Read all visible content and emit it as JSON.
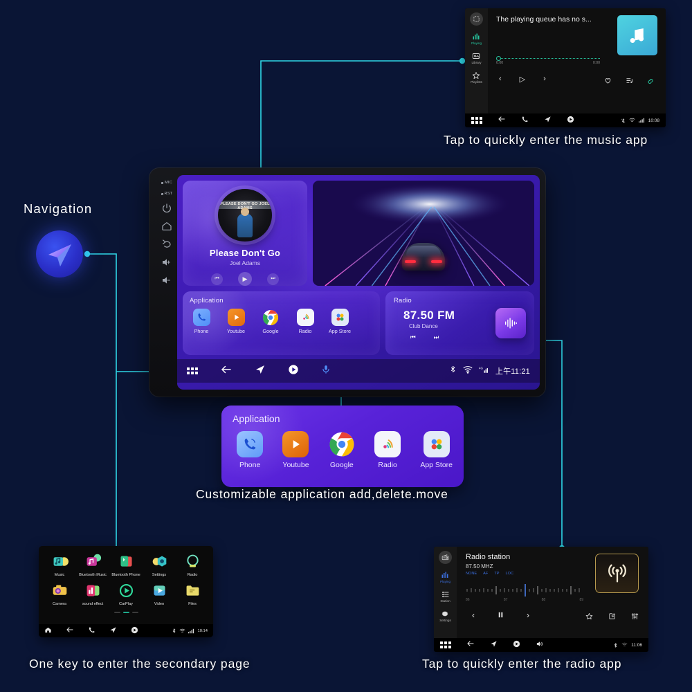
{
  "theme": {
    "bg": "#0a1535",
    "connector": "#2fd8e8",
    "accent_purple": "#6b34e8"
  },
  "navigation_callout": {
    "title": "Navigation",
    "icon": "navigation-arrow-icon"
  },
  "captions": {
    "music": "Tap to quickly enter the music app",
    "customizable": "Customizable application add,delete.move",
    "secondary": "One key to enter the secondary page",
    "radio": "Tap to quickly enter the radio app"
  },
  "head_unit": {
    "side_buttons": [
      {
        "label": "MIC",
        "icon": "mic-pinhole-icon"
      },
      {
        "label": "RST",
        "icon": "reset-pinhole-icon"
      },
      {
        "label": "",
        "icon": "power-icon"
      },
      {
        "label": "",
        "icon": "home-icon"
      },
      {
        "label": "",
        "icon": "back-icon"
      },
      {
        "label": "",
        "icon": "volume-up-icon"
      },
      {
        "label": "",
        "icon": "volume-down-icon"
      }
    ],
    "music_card": {
      "title": "Please Don't Go",
      "artist": "Joel Adams",
      "album_art_text": "PLEASE DON'T GO JOEL ADAMS",
      "controls": [
        {
          "name": "previous-button",
          "glyph": "⏮"
        },
        {
          "name": "play-button",
          "glyph": "▶"
        },
        {
          "name": "next-button",
          "glyph": "⏭"
        }
      ]
    },
    "application_card": {
      "label": "Application",
      "apps": [
        {
          "name": "Phone",
          "icon": "phone-icon",
          "color": "#4f8ef7"
        },
        {
          "name": "Youtube",
          "icon": "youtube-icon",
          "color": "#e8740c"
        },
        {
          "name": "Google",
          "icon": "google-chrome-icon",
          "color": "#ffffff"
        },
        {
          "name": "Radio",
          "icon": "radio-waves-icon",
          "color": "#f2f4f8"
        },
        {
          "name": "App Store",
          "icon": "app-store-icon",
          "color": "#dfe6f5"
        }
      ]
    },
    "radio_card": {
      "label": "Radio",
      "frequency": "87.50 FM",
      "station": "Club Dance",
      "controls": [
        {
          "name": "prev-station-button",
          "glyph": "⏮"
        },
        {
          "name": "next-station-button",
          "glyph": "⏭"
        }
      ],
      "tile_icon": "audio-wave-icon"
    },
    "navbar": {
      "items": [
        {
          "name": "apps-grid-button",
          "icon": "grid-icon"
        },
        {
          "name": "back-button",
          "icon": "arrow-left-icon"
        },
        {
          "name": "navigation-button",
          "icon": "navigation-arrow-icon"
        },
        {
          "name": "media-button",
          "icon": "play-circle-icon"
        },
        {
          "name": "voice-button",
          "icon": "microphone-icon"
        }
      ],
      "status": {
        "bluetooth": "bluetooth-icon",
        "wifi": "wifi-icon",
        "signal": "signal-4g-icon",
        "time": "上午11:21"
      }
    }
  },
  "music_app": {
    "sidebar": [
      {
        "label": "",
        "icon": "album-round-icon",
        "active": false
      },
      {
        "label": "Playing",
        "icon": "equalizer-icon",
        "active": true
      },
      {
        "label": "Library",
        "icon": "library-icon",
        "active": false
      },
      {
        "label": "Playlists",
        "icon": "star-icon",
        "active": false
      }
    ],
    "queue_message": "The playing queue has no s...",
    "progress": {
      "elapsed": "0:00",
      "total": "0:00",
      "percent": 0
    },
    "controls": [
      {
        "name": "previous-button",
        "glyph": "‹"
      },
      {
        "name": "play-button",
        "glyph": "▷"
      },
      {
        "name": "next-button",
        "glyph": "›"
      }
    ],
    "controls_right": [
      {
        "name": "favorite-icon",
        "glyph": "♡"
      },
      {
        "name": "queue-list-icon",
        "glyph": "≡"
      },
      {
        "name": "repeat-icon",
        "glyph": "∞"
      }
    ],
    "album_icon": "music-note-icon",
    "sysbar": {
      "items": [
        {
          "name": "apps-grid-button",
          "icon": "grid-icon"
        },
        {
          "name": "back-button",
          "icon": "arrow-left-icon"
        },
        {
          "name": "phone-button",
          "icon": "phone-handset-icon"
        },
        {
          "name": "navigation-button",
          "icon": "navigation-arrow-icon"
        },
        {
          "name": "media-button",
          "icon": "play-circle-icon"
        }
      ],
      "time": "10:08"
    }
  },
  "radio_app": {
    "sidebar": [
      {
        "label": "",
        "icon": "radio-device-icon",
        "active": false
      },
      {
        "label": "Playing",
        "icon": "equalizer-icon",
        "active": true
      },
      {
        "label": "Station",
        "icon": "list-icon",
        "active": false
      },
      {
        "label": "Settings",
        "icon": "gear-icon",
        "active": false
      }
    ],
    "title": "Radio station",
    "frequency": "87.50 MHZ",
    "tags": [
      "NONE",
      "AF",
      "TP",
      "LOC"
    ],
    "scale_labels": [
      "86",
      "87",
      "88",
      "89"
    ],
    "current_mark": 87.5,
    "controls": [
      {
        "name": "tune-down-button",
        "glyph": "‹"
      },
      {
        "name": "pause-button",
        "glyph": "⏸"
      },
      {
        "name": "tune-up-button",
        "glyph": "›"
      }
    ],
    "controls_right": [
      {
        "name": "favorite-icon",
        "glyph": "☆"
      },
      {
        "name": "edit-icon",
        "glyph": "✎"
      },
      {
        "name": "equalizer-icon",
        "glyph": "≡"
      }
    ],
    "tile_icon": "radio-tower-icon",
    "sysbar": {
      "items": [
        {
          "name": "apps-grid-button",
          "icon": "grid-icon"
        },
        {
          "name": "back-button",
          "icon": "arrow-left-icon"
        },
        {
          "name": "navigation-button",
          "icon": "navigation-arrow-icon"
        },
        {
          "name": "media-button",
          "icon": "play-circle-icon"
        },
        {
          "name": "volume-button",
          "icon": "speaker-icon"
        }
      ],
      "time": "11:06"
    }
  },
  "secondary_page": {
    "row1": [
      {
        "name": "Music",
        "icon": "music-app-icon"
      },
      {
        "name": "Bluetooth Music",
        "icon": "bluetooth-music-icon"
      },
      {
        "name": "Bluetooth Phone",
        "icon": "bluetooth-phone-icon"
      },
      {
        "name": "Settings",
        "icon": "settings-app-icon"
      },
      {
        "name": "Radio",
        "icon": "radio-app-icon"
      }
    ],
    "row2": [
      {
        "name": "Camera",
        "icon": "camera-app-icon"
      },
      {
        "name": "sound effect",
        "icon": "sound-effect-icon"
      },
      {
        "name": "CarPlay",
        "icon": "carplay-icon"
      },
      {
        "name": "Video",
        "icon": "video-app-icon"
      },
      {
        "name": "Files",
        "icon": "files-app-icon"
      }
    ],
    "page_dots": {
      "count": 3,
      "active": 1
    },
    "sysbar": {
      "items": [
        {
          "name": "home-button",
          "icon": "home-icon"
        },
        {
          "name": "back-button",
          "icon": "arrow-left-icon"
        },
        {
          "name": "phone-button",
          "icon": "phone-handset-icon"
        },
        {
          "name": "navigation-button",
          "icon": "navigation-arrow-icon"
        },
        {
          "name": "media-button",
          "icon": "play-circle-icon"
        }
      ],
      "time": "10:14"
    }
  },
  "application_card_big": {
    "label": "Application",
    "apps": [
      {
        "name": "Phone",
        "icon": "phone-icon"
      },
      {
        "name": "Youtube",
        "icon": "youtube-icon"
      },
      {
        "name": "Google",
        "icon": "google-chrome-icon"
      },
      {
        "name": "Radio",
        "icon": "radio-waves-icon"
      },
      {
        "name": "App Store",
        "icon": "app-store-icon"
      }
    ]
  }
}
